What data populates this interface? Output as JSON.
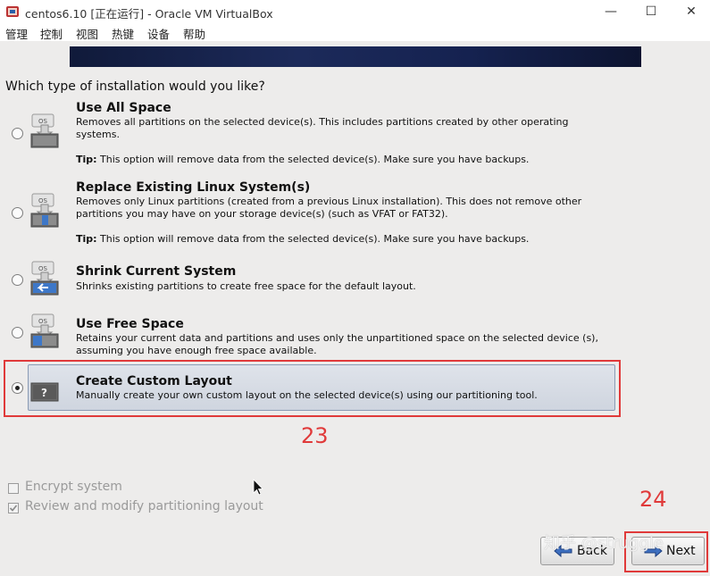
{
  "window": {
    "title": "centos6.10 [正在运行] - Oracle VM VirtualBox",
    "minimize": "—",
    "maximize": "☐",
    "close": "✕"
  },
  "menu": [
    "管理",
    "控制",
    "视图",
    "热键",
    "设备",
    "帮助"
  ],
  "installer": {
    "question": "Which type of installation would you like?",
    "tip_label": "Tip:",
    "options": [
      {
        "title": "Use All Space",
        "desc": "Removes all partitions on the selected device(s).  This includes partitions created by other operating systems.",
        "tip": "This option will remove data from the selected device(s).  Make sure you have backups.",
        "selected": false,
        "icon": "disk-os-icon"
      },
      {
        "title": "Replace Existing Linux System(s)",
        "desc": "Removes only Linux partitions (created from a previous Linux installation).  This does not remove other partitions you may have on your storage device(s) (such as VFAT or FAT32).",
        "tip": "This option will remove data from the selected device(s).  Make sure you have backups.",
        "selected": false,
        "icon": "disk-linux-icon"
      },
      {
        "title": "Shrink Current System",
        "desc": "Shrinks existing partitions to create free space for the default layout.",
        "selected": false,
        "icon": "disk-shrink-icon"
      },
      {
        "title": "Use Free Space",
        "desc": "Retains your current data and partitions and uses only the unpartitioned space on the selected device (s), assuming you have enough free space available.",
        "selected": false,
        "icon": "disk-free-space-icon"
      },
      {
        "title": "Create Custom Layout",
        "desc": "Manually create your own custom layout on the selected device(s) using our partitioning tool.",
        "selected": true,
        "icon": "disk-custom-icon"
      }
    ],
    "encrypt_label": "Encrypt system",
    "review_label": "Review and modify partitioning layout",
    "back_label": "Back",
    "next_label": "Next"
  },
  "annotations": {
    "a23": "23",
    "a24": "24"
  },
  "watermark": "知乎 @struggle",
  "colors": {
    "accent_red": "#e03a3a",
    "banner": "#152250"
  }
}
